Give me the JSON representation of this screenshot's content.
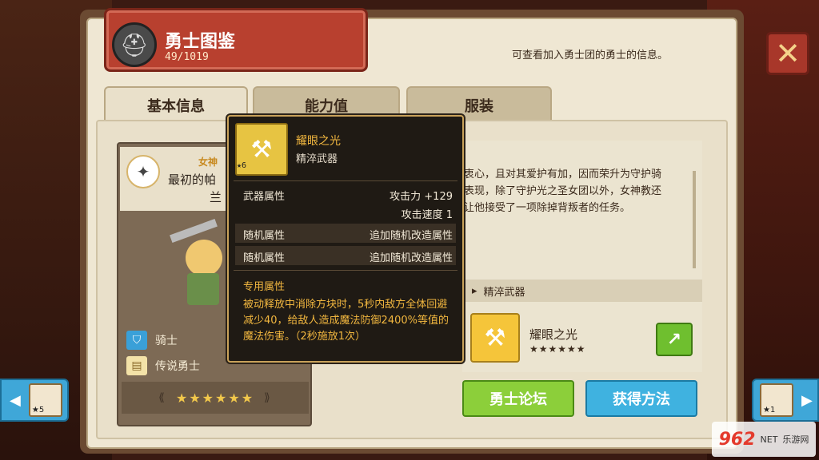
{
  "header": {
    "title": "勇士图鉴",
    "count": "49/1019",
    "subtitle": "可查看加入勇士团的勇士的信息。"
  },
  "tabs": [
    {
      "label": "基本信息",
      "active": true
    },
    {
      "label": "能力值",
      "active": false
    },
    {
      "label": "服装",
      "active": false
    }
  ],
  "hero": {
    "class_label": "女神",
    "name_line1": "最初的帕",
    "name_line2": "兰",
    "role": "骑士",
    "rank": "传说勇士",
    "stars": "★★★★★★"
  },
  "description": "...衷心，且对其爱护有加，因而荣升为守护骑士...表现，除了守护光之圣女团以外，女神教还...让他接受了一项除掉背叛者的任务。",
  "description_lines": [
    "衷心，且对其爱护有加，因而荣升为守护骑",
    "表现，除了守护光之圣女团以外，女神教还",
    "让他接受了一项除掉背叛者的任务。"
  ],
  "weapon_section": {
    "label": "精淬武器",
    "name": "耀眼之光",
    "stars": "★★★★★★"
  },
  "buttons": {
    "forum": "勇士论坛",
    "obtain": "获得方法"
  },
  "nav": {
    "left_stars": "5",
    "right_stars": "1"
  },
  "tooltip": {
    "name": "耀眼之光",
    "type": "精淬武器",
    "badge": "6",
    "weapon_attr_label": "武器属性",
    "attack": "攻击力 +129",
    "attack_speed": "攻击速度 1",
    "random_label_1": "随机属性",
    "random_value_1": "追加随机改造属性",
    "random_label_2": "随机属性",
    "random_value_2": "追加随机改造属性",
    "special_label": "专用属性",
    "special_text": "被动释放中消除方块时，5秒内敌方全体回避减少40，给敌人造成魔法防御2400%等值的魔法伤害。（2秒施放1次）"
  },
  "watermark": {
    "num": "962",
    "suffix": "NET",
    "text": "乐游网"
  },
  "colors": {
    "title_red": "#b8402f",
    "forum_green": "#8ccf3a",
    "obtain_blue": "#3fb2e0",
    "tooltip_gold": "#f2b73f"
  }
}
